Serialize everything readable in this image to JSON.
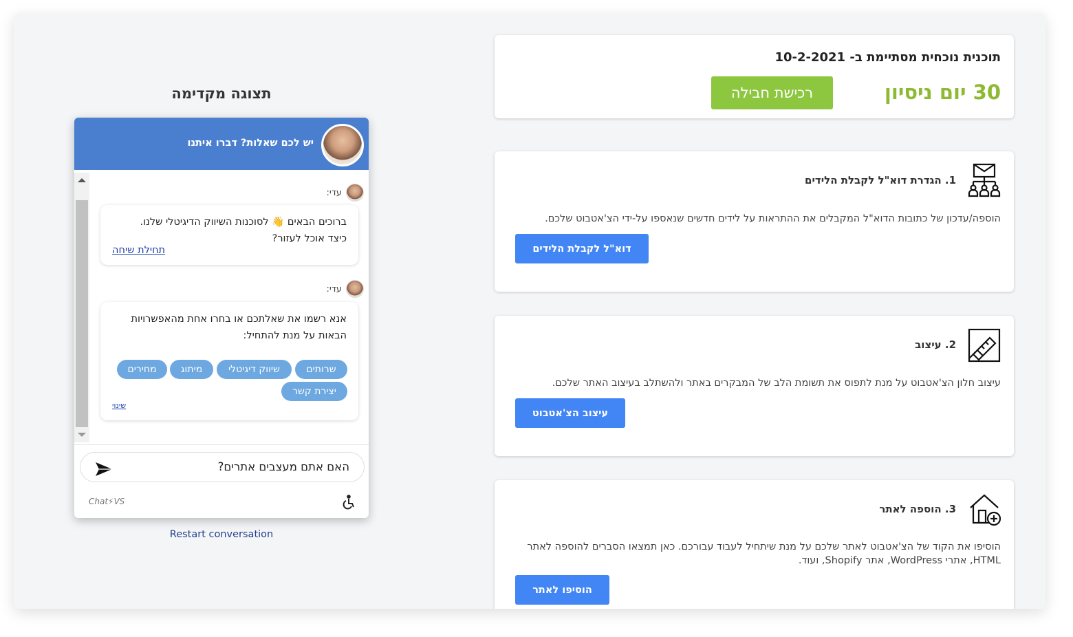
{
  "plan": {
    "title": "תוכנית נוכחית מסתיימת ב- 10-2-2021",
    "trial": "30 יום ניסיון",
    "buy_label": "רכישת חבילה"
  },
  "steps": [
    {
      "title": "1. הגדרת דוא\"ל לקבלת הלידים",
      "description": "הוספה/עדכון של כתובות הדוא\"ל המקבלים את ההתראות על לידים חדשים שנאספו על-ידי הצ'אטבוט שלכם.",
      "button": "דוא\"ל לקבלת הלידים",
      "icon": "network-email-icon"
    },
    {
      "title": "2. עיצוב",
      "description": "עיצוב חלון הצ'אטבוט על מנת לתפוס את תשומת הלב של המבקרים באתר ולהשתלב בעיצוב האתר שלכם.",
      "button": "עיצוב הצ'אטבוט",
      "icon": "design-pen-icon"
    },
    {
      "title": "3. הוספה לאתר",
      "description": "הוסיפו את הקוד של הצ'אטבוט לאתר שלכם על מנת שיתחיל לעבוד עבורכם. כאן תמצאו הסברים להוספה לאתר HTML, אתרי WordPress, אתר Shopify, ועוד.",
      "button": "הוסיפו לאתר",
      "icon": "add-house-icon"
    }
  ],
  "preview": {
    "title": "תצוגה מקדימה",
    "restart": "Restart conversation"
  },
  "widget": {
    "header": "יש לכם שאלות? דברו איתנו",
    "messages": [
      {
        "sender": "עדי:",
        "lines": [
          "ברוכים הבאים 👋 לסוכנות השיווק הדיגיטלי שלנו.",
          "כיצד אוכל לעזור?"
        ],
        "link": "תחילת שיחה"
      },
      {
        "sender": "עדי:",
        "lines": [
          "אנא רשמו את שאלתכם או בחרו אחת מהאפשרויות",
          "הבאות על מנת להתחיל:"
        ],
        "link": "שינוי",
        "chips": [
          "שרותים",
          "שיווק דיגיטלי",
          "מיתוג",
          "מחירים",
          "יצירת קשר"
        ]
      }
    ],
    "input_value": "האם אתם מעצבים אתרים?",
    "brand": "Chat⚡VS"
  }
}
